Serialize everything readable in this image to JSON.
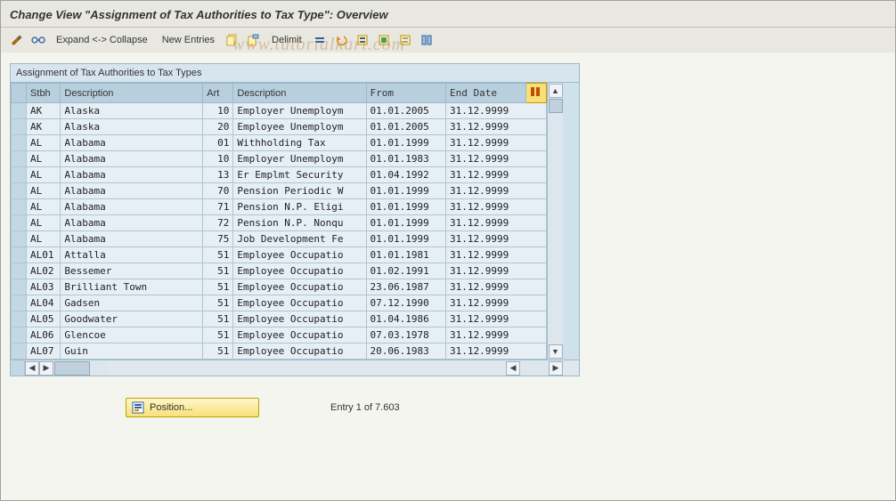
{
  "title": "Change View \"Assignment of Tax Authorities to Tax Type\": Overview",
  "watermark": "www.tutorialkart.com",
  "toolbar": {
    "expand_collapse": "Expand <-> Collapse",
    "new_entries": "New Entries",
    "delimit": "Delimit"
  },
  "panel": {
    "header": "Assignment of Tax Authorities to Tax Types",
    "columns": {
      "sel": "",
      "stbh": "Stbh",
      "desc1": "Description",
      "art": "Art",
      "desc2": "Description",
      "from": "From",
      "end": "End Date"
    },
    "rows": [
      {
        "stbh": "AK",
        "desc1": "Alaska",
        "art": "10",
        "desc2": "Employer Unemploym",
        "from": "01.01.2005",
        "end": "31.12.9999"
      },
      {
        "stbh": "AK",
        "desc1": "Alaska",
        "art": "20",
        "desc2": "Employee Unemploym",
        "from": "01.01.2005",
        "end": "31.12.9999"
      },
      {
        "stbh": "AL",
        "desc1": "Alabama",
        "art": "01",
        "desc2": "Withholding Tax",
        "from": "01.01.1999",
        "end": "31.12.9999"
      },
      {
        "stbh": "AL",
        "desc1": "Alabama",
        "art": "10",
        "desc2": "Employer Unemploym",
        "from": "01.01.1983",
        "end": "31.12.9999"
      },
      {
        "stbh": "AL",
        "desc1": "Alabama",
        "art": "13",
        "desc2": "Er Emplmt Security",
        "from": "01.04.1992",
        "end": "31.12.9999"
      },
      {
        "stbh": "AL",
        "desc1": "Alabama",
        "art": "70",
        "desc2": "Pension Periodic W",
        "from": "01.01.1999",
        "end": "31.12.9999"
      },
      {
        "stbh": "AL",
        "desc1": "Alabama",
        "art": "71",
        "desc2": "Pension N.P. Eligi",
        "from": "01.01.1999",
        "end": "31.12.9999"
      },
      {
        "stbh": "AL",
        "desc1": "Alabama",
        "art": "72",
        "desc2": "Pension N.P. Nonqu",
        "from": "01.01.1999",
        "end": "31.12.9999"
      },
      {
        "stbh": "AL",
        "desc1": "Alabama",
        "art": "75",
        "desc2": "Job Development Fe",
        "from": "01.01.1999",
        "end": "31.12.9999"
      },
      {
        "stbh": "AL01",
        "desc1": "Attalla",
        "art": "51",
        "desc2": "Employee Occupatio",
        "from": "01.01.1981",
        "end": "31.12.9999"
      },
      {
        "stbh": "AL02",
        "desc1": "Bessemer",
        "art": "51",
        "desc2": "Employee Occupatio",
        "from": "01.02.1991",
        "end": "31.12.9999"
      },
      {
        "stbh": "AL03",
        "desc1": "Brilliant Town",
        "art": "51",
        "desc2": "Employee Occupatio",
        "from": "23.06.1987",
        "end": "31.12.9999"
      },
      {
        "stbh": "AL04",
        "desc1": "Gadsen",
        "art": "51",
        "desc2": "Employee Occupatio",
        "from": "07.12.1990",
        "end": "31.12.9999"
      },
      {
        "stbh": "AL05",
        "desc1": "Goodwater",
        "art": "51",
        "desc2": "Employee Occupatio",
        "from": "01.04.1986",
        "end": "31.12.9999"
      },
      {
        "stbh": "AL06",
        "desc1": "Glencoe",
        "art": "51",
        "desc2": "Employee Occupatio",
        "from": "07.03.1978",
        "end": "31.12.9999"
      },
      {
        "stbh": "AL07",
        "desc1": "Guin",
        "art": "51",
        "desc2": "Employee Occupatio",
        "from": "20.06.1983",
        "end": "31.12.9999"
      }
    ]
  },
  "footer": {
    "position_label": "Position...",
    "entry_text": "Entry 1 of 7.603"
  }
}
